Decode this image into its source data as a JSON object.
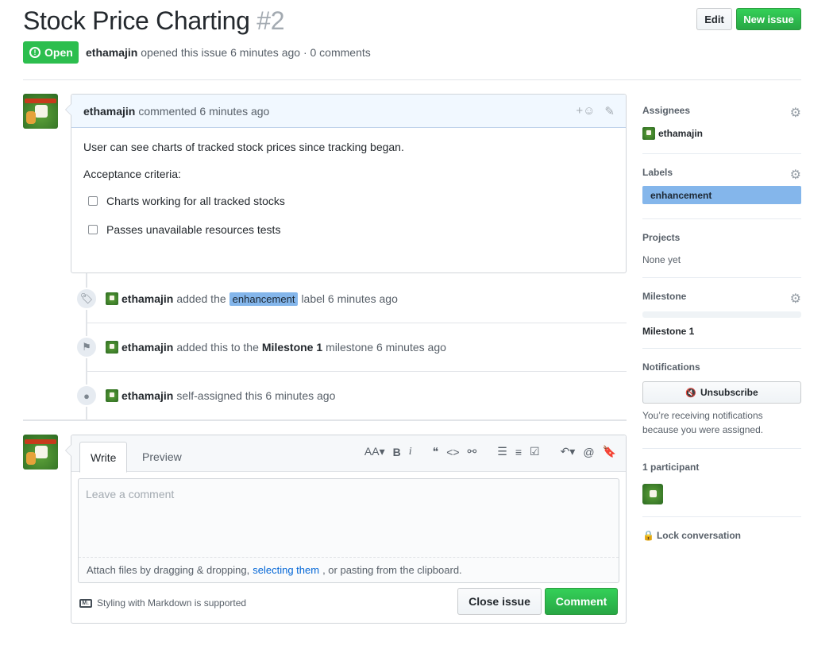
{
  "issue": {
    "title": "Stock Price Charting",
    "number": "#2",
    "state": "Open",
    "author": "ethamajin",
    "opened_text": "opened this issue 6 minutes ago · 0 comments"
  },
  "header_buttons": {
    "edit": "Edit",
    "new_issue": "New issue"
  },
  "comment": {
    "author": "ethamajin",
    "time": "commented 6 minutes ago",
    "body": "User can see charts of tracked stock prices since tracking began.",
    "criteria_heading": "Acceptance criteria:",
    "tasks": [
      "Charts working for all tracked stocks",
      "Passes unavailable resources tests"
    ]
  },
  "events": [
    {
      "user": "ethamajin",
      "pre": "added the",
      "label": "enhancement",
      "post": "label 6 minutes ago"
    },
    {
      "user": "ethamajin",
      "pre": "added this to the",
      "milestone": "Milestone 1",
      "post": "milestone 6 minutes ago"
    },
    {
      "user": "ethamajin",
      "pre": "self-assigned this 6 minutes ago"
    }
  ],
  "new_comment": {
    "tab_write": "Write",
    "tab_preview": "Preview",
    "placeholder": "Leave a comment",
    "attach_pre": "Attach files by dragging & dropping,",
    "attach_link": "selecting them",
    "attach_post": ", or pasting from the clipboard.",
    "markdown_note": "Styling with Markdown is supported",
    "close_button": "Close issue",
    "comment_button": "Comment",
    "markdown_icon": "M↓"
  },
  "toolbar": {
    "text_size": "AA▾",
    "bold": "B",
    "italic": "i",
    "quote": "❝",
    "code": "<>",
    "link": "⚯",
    "ul": "☰",
    "ol": "≡",
    "task": "☑",
    "reply": "↶▾",
    "mention": "@",
    "saved": "🔖"
  },
  "sidebar": {
    "assignees_heading": "Assignees",
    "assignee": "ethamajin",
    "labels_heading": "Labels",
    "label": "enhancement",
    "projects_heading": "Projects",
    "projects_value": "None yet",
    "milestone_heading": "Milestone",
    "milestone_value": "Milestone 1",
    "notifications_heading": "Notifications",
    "unsubscribe": "Unsubscribe",
    "unsubscribe_icon": "🔇",
    "notify_text": "You’re receiving notifications because you were assigned.",
    "participants_heading": "1 participant",
    "lock": "Lock conversation"
  },
  "colors": {
    "open_green": "#2cbe4e",
    "label_blue": "#84b6eb",
    "link": "#0366d6"
  }
}
